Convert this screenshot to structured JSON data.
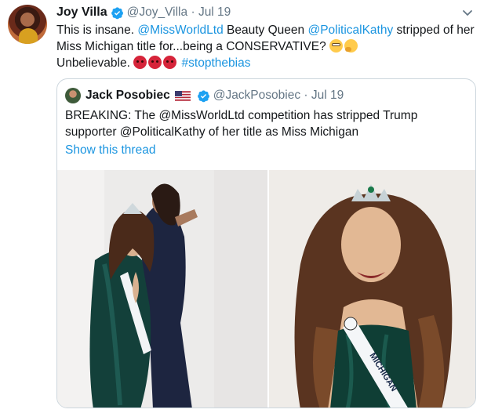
{
  "tweet": {
    "display_name": "Joy Villa",
    "handle": "@Joy_Villa",
    "separator": "·",
    "date": "Jul 19",
    "text_segments": [
      "This is insane. ",
      "@MissWorldLtd",
      " Beauty Queen ",
      "@PoliticalKathy",
      " stripped of her Miss Michigan title for...being a CONSERVATIVE? ",
      " Unbelievable. ",
      "#stopthebias"
    ],
    "emoji_sequence_1": [
      "flushed-face",
      "thinking-face"
    ],
    "emoji_sequence_2": [
      "angry-face",
      "angry-face",
      "angry-face"
    ]
  },
  "quoted": {
    "display_name": "Jack Posobiec",
    "flag": "us-flag",
    "handle": "@JackPosobiec",
    "separator": "·",
    "date": "Jul 19",
    "text": "BREAKING: The @MissWorldLtd competition has stripped Trump supporter @PoliticalKathy of her title as Miss Michigan",
    "show_thread": "Show this thread",
    "photo_sash_text": "MICHIGAN"
  },
  "colors": {
    "link": "#1b95e0",
    "text": "#14171a",
    "meta": "#657786",
    "border": "#ccd6dd",
    "verified": "#1da1f2"
  }
}
